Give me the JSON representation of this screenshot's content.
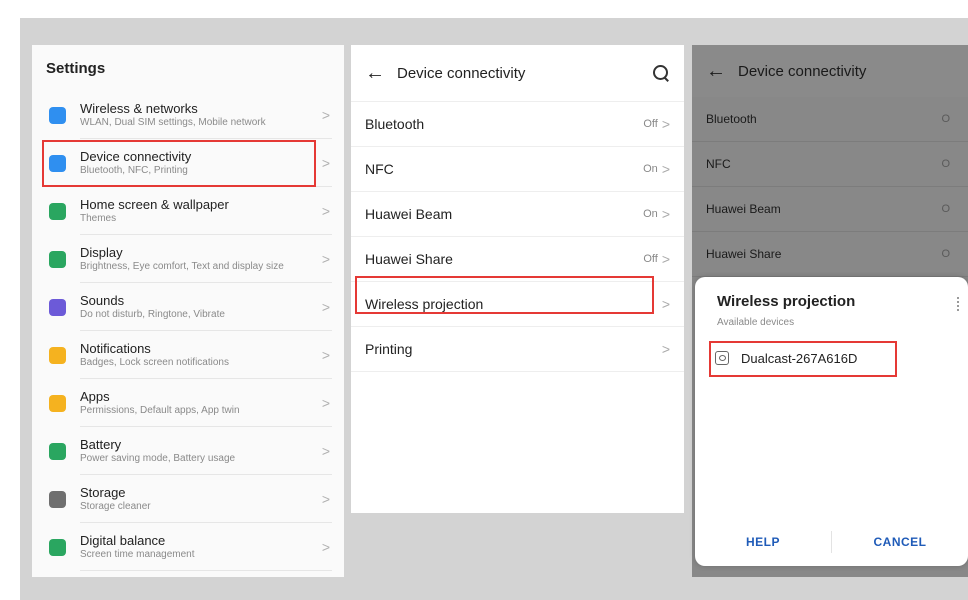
{
  "settings": {
    "title": "Settings",
    "items": [
      {
        "title": "Wireless & networks",
        "subtitle": "WLAN, Dual SIM settings, Mobile network",
        "icon": "wifi-icon",
        "color": "#2f8ff0"
      },
      {
        "title": "Device connectivity",
        "subtitle": "Bluetooth, NFC, Printing",
        "icon": "device-connectivity-icon",
        "color": "#2f8ff0"
      },
      {
        "title": "Home screen & wallpaper",
        "subtitle": "Themes",
        "icon": "wallpaper-icon",
        "color": "#2aa660"
      },
      {
        "title": "Display",
        "subtitle": "Brightness, Eye comfort, Text and display size",
        "icon": "display-icon",
        "color": "#2aa660"
      },
      {
        "title": "Sounds",
        "subtitle": "Do not disturb, Ringtone, Vibrate",
        "icon": "sound-icon",
        "color": "#6c5ad8"
      },
      {
        "title": "Notifications",
        "subtitle": "Badges, Lock screen notifications",
        "icon": "bell-icon",
        "color": "#f5b21f"
      },
      {
        "title": "Apps",
        "subtitle": "Permissions, Default apps, App twin",
        "icon": "apps-icon",
        "color": "#f5b21f"
      },
      {
        "title": "Battery",
        "subtitle": "Power saving mode, Battery usage",
        "icon": "battery-icon",
        "color": "#2aa660"
      },
      {
        "title": "Storage",
        "subtitle": "Storage cleaner",
        "icon": "storage-icon",
        "color": "#6f6f6f"
      },
      {
        "title": "Digital balance",
        "subtitle": "Screen time management",
        "icon": "hourglass-icon",
        "color": "#2aa660"
      }
    ]
  },
  "device_connectivity": {
    "title": "Device connectivity",
    "items": [
      {
        "label": "Bluetooth",
        "status": "Off"
      },
      {
        "label": "NFC",
        "status": "On"
      },
      {
        "label": "Huawei Beam",
        "status": "On"
      },
      {
        "label": "Huawei Share",
        "status": "Off"
      },
      {
        "label": "Wireless projection",
        "status": ""
      },
      {
        "label": "Printing",
        "status": ""
      }
    ]
  },
  "projection_screen": {
    "title": "Device connectivity",
    "items": [
      {
        "label": "Bluetooth",
        "status": "O"
      },
      {
        "label": "NFC",
        "status": "O"
      },
      {
        "label": "Huawei Beam",
        "status": "O"
      },
      {
        "label": "Huawei Share",
        "status": "O"
      }
    ],
    "dialog": {
      "title": "Wireless projection",
      "subtitle": "Available devices",
      "device_name": "Dualcast-267A616D",
      "help_label": "HELP",
      "cancel_label": "CANCEL"
    }
  },
  "colors": {
    "highlight": "#e53935",
    "accent": "#1f5bb8"
  }
}
